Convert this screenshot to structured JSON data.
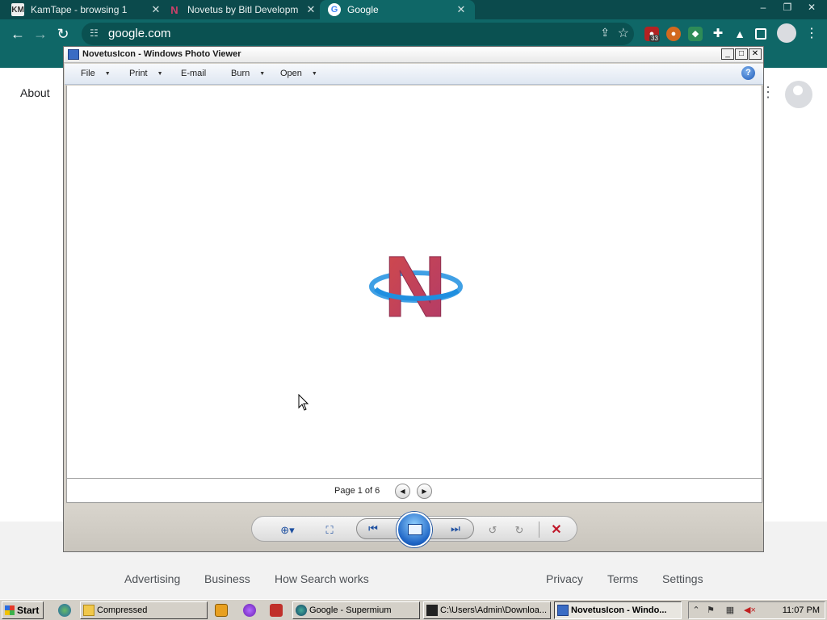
{
  "browser": {
    "tabs": [
      {
        "title": "KamTape - browsing 1",
        "active": false
      },
      {
        "title": "Novetus by Bitl Developm",
        "active": false
      },
      {
        "title": "Google",
        "active": true
      }
    ],
    "address": "google.com",
    "extension_badge": "33",
    "window_controls": [
      "–",
      "❐",
      "✕"
    ]
  },
  "google": {
    "about_link": "About",
    "footer_links_left": [
      "Advertising",
      "Business",
      "How Search works"
    ],
    "footer_links_right": [
      "Privacy",
      "Terms",
      "Settings"
    ]
  },
  "photo_viewer": {
    "title": "NovetusIcon - Windows Photo Viewer",
    "menu": [
      {
        "label": "File",
        "dropdown": true
      },
      {
        "label": "Print",
        "dropdown": true
      },
      {
        "label": "E-mail",
        "dropdown": false
      },
      {
        "label": "Burn",
        "dropdown": true
      },
      {
        "label": "Open",
        "dropdown": true
      }
    ],
    "help_glyph": "?",
    "page_indicator": "Page 1 of 6",
    "image_glyph": "N",
    "colors": {
      "logo_red": "#c0395a",
      "logo_ring": "#1f8fe0",
      "delete": "#c0182a"
    }
  },
  "taskbar": {
    "start_label": "Start",
    "tasks": [
      {
        "label": "Compressed",
        "active": false
      },
      {
        "label": "Google - Supermium",
        "active": false
      },
      {
        "label": "C:\\Users\\Admin\\Downloa...",
        "active": false
      },
      {
        "label": "NovetusIcon - Windo...",
        "active": true
      }
    ],
    "clock": "11:07 PM"
  }
}
